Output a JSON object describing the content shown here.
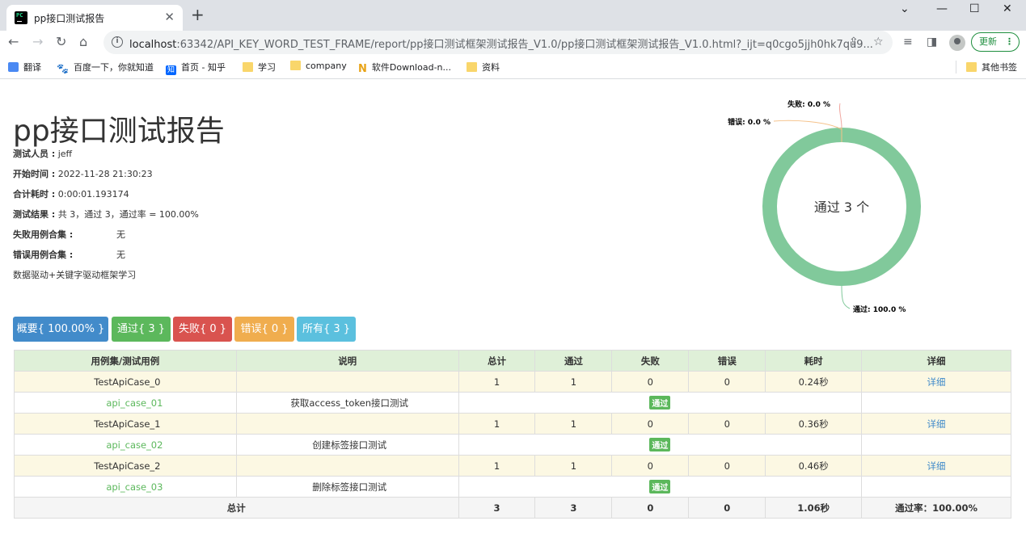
{
  "browser": {
    "tab_title": "pp接口测试报告",
    "url_host": "localhost",
    "url_rest": ":63342/API_KEY_WORD_TEST_FRAME/report/pp接口测试框架测试报告_V1.0/pp接口测试框架测试报告_V1.0.html?_ijt=q0cgo5jjh0hk7qu9...",
    "update_label": "更新",
    "bookmarks": [
      "翻译",
      "百度一下，你就知道",
      "首页 - 知乎",
      "学习",
      "company",
      "软件Download-n...",
      "资料"
    ],
    "other_bookmarks": "其他书签"
  },
  "report": {
    "title": "pp接口测试报告",
    "tester_label": "测试人员 :",
    "tester": "jeff",
    "start_label": "开始时间 :",
    "start": "2022-11-28 21:30:23",
    "duration_label": "合计耗时 :",
    "duration": "0:00:01.193174",
    "result_label": "测试结果 :",
    "result": "共 3，通过 3，通过率 = 100.00%",
    "failed_label": "失败用例合集 :",
    "failed": "无",
    "error_label": "错误用例合集 :",
    "error": "无",
    "description": "数据驱动+关键字驱动框架学习"
  },
  "chart_data": {
    "type": "pie",
    "center_text": "通过 3 个",
    "slices": [
      {
        "name": "通过",
        "value": 100.0,
        "label": "通过",
        "label_value": "100.0 %",
        "color": "#81c99b"
      },
      {
        "name": "失败",
        "value": 0.0,
        "label": "失败",
        "label_value": "0.0 %",
        "color": "#f0a7a0"
      },
      {
        "name": "错误",
        "value": 0.0,
        "label": "错误",
        "label_value": "0.0 %",
        "color": "#f5c28a"
      }
    ]
  },
  "filters": [
    {
      "label": "概要{ 100.00% }",
      "color": "#428bca"
    },
    {
      "label": "通过{ 3 }",
      "color": "#5cb85c"
    },
    {
      "label": "失败{ 0 }",
      "color": "#d9534f"
    },
    {
      "label": "错误{ 0 }",
      "color": "#f0ad4e"
    },
    {
      "label": "所有{ 3 }",
      "color": "#5bc0de"
    }
  ],
  "table": {
    "headers": [
      "用例集/测试用例",
      "说明",
      "总计",
      "通过",
      "失败",
      "错误",
      "耗时",
      "详细"
    ],
    "suites": [
      {
        "name": "TestApiCase_0",
        "desc": "",
        "total": "1",
        "pass": "1",
        "fail": "0",
        "error": "0",
        "time": "0.24秒",
        "detail": "详细",
        "case": {
          "name": "api_case_01",
          "desc": "获取access_token接口测试",
          "status": "通过"
        }
      },
      {
        "name": "TestApiCase_1",
        "desc": "",
        "total": "1",
        "pass": "1",
        "fail": "0",
        "error": "0",
        "time": "0.36秒",
        "detail": "详细",
        "case": {
          "name": "api_case_02",
          "desc": "创建标签接口测试",
          "status": "通过"
        }
      },
      {
        "name": "TestApiCase_2",
        "desc": "",
        "total": "1",
        "pass": "1",
        "fail": "0",
        "error": "0",
        "time": "0.46秒",
        "detail": "详细",
        "case": {
          "name": "api_case_03",
          "desc": "删除标签接口测试",
          "status": "通过"
        }
      }
    ],
    "footer": {
      "label": "总计",
      "total": "3",
      "pass": "3",
      "fail": "0",
      "error": "0",
      "time": "1.06秒",
      "rate": "通过率：100.00%"
    }
  }
}
